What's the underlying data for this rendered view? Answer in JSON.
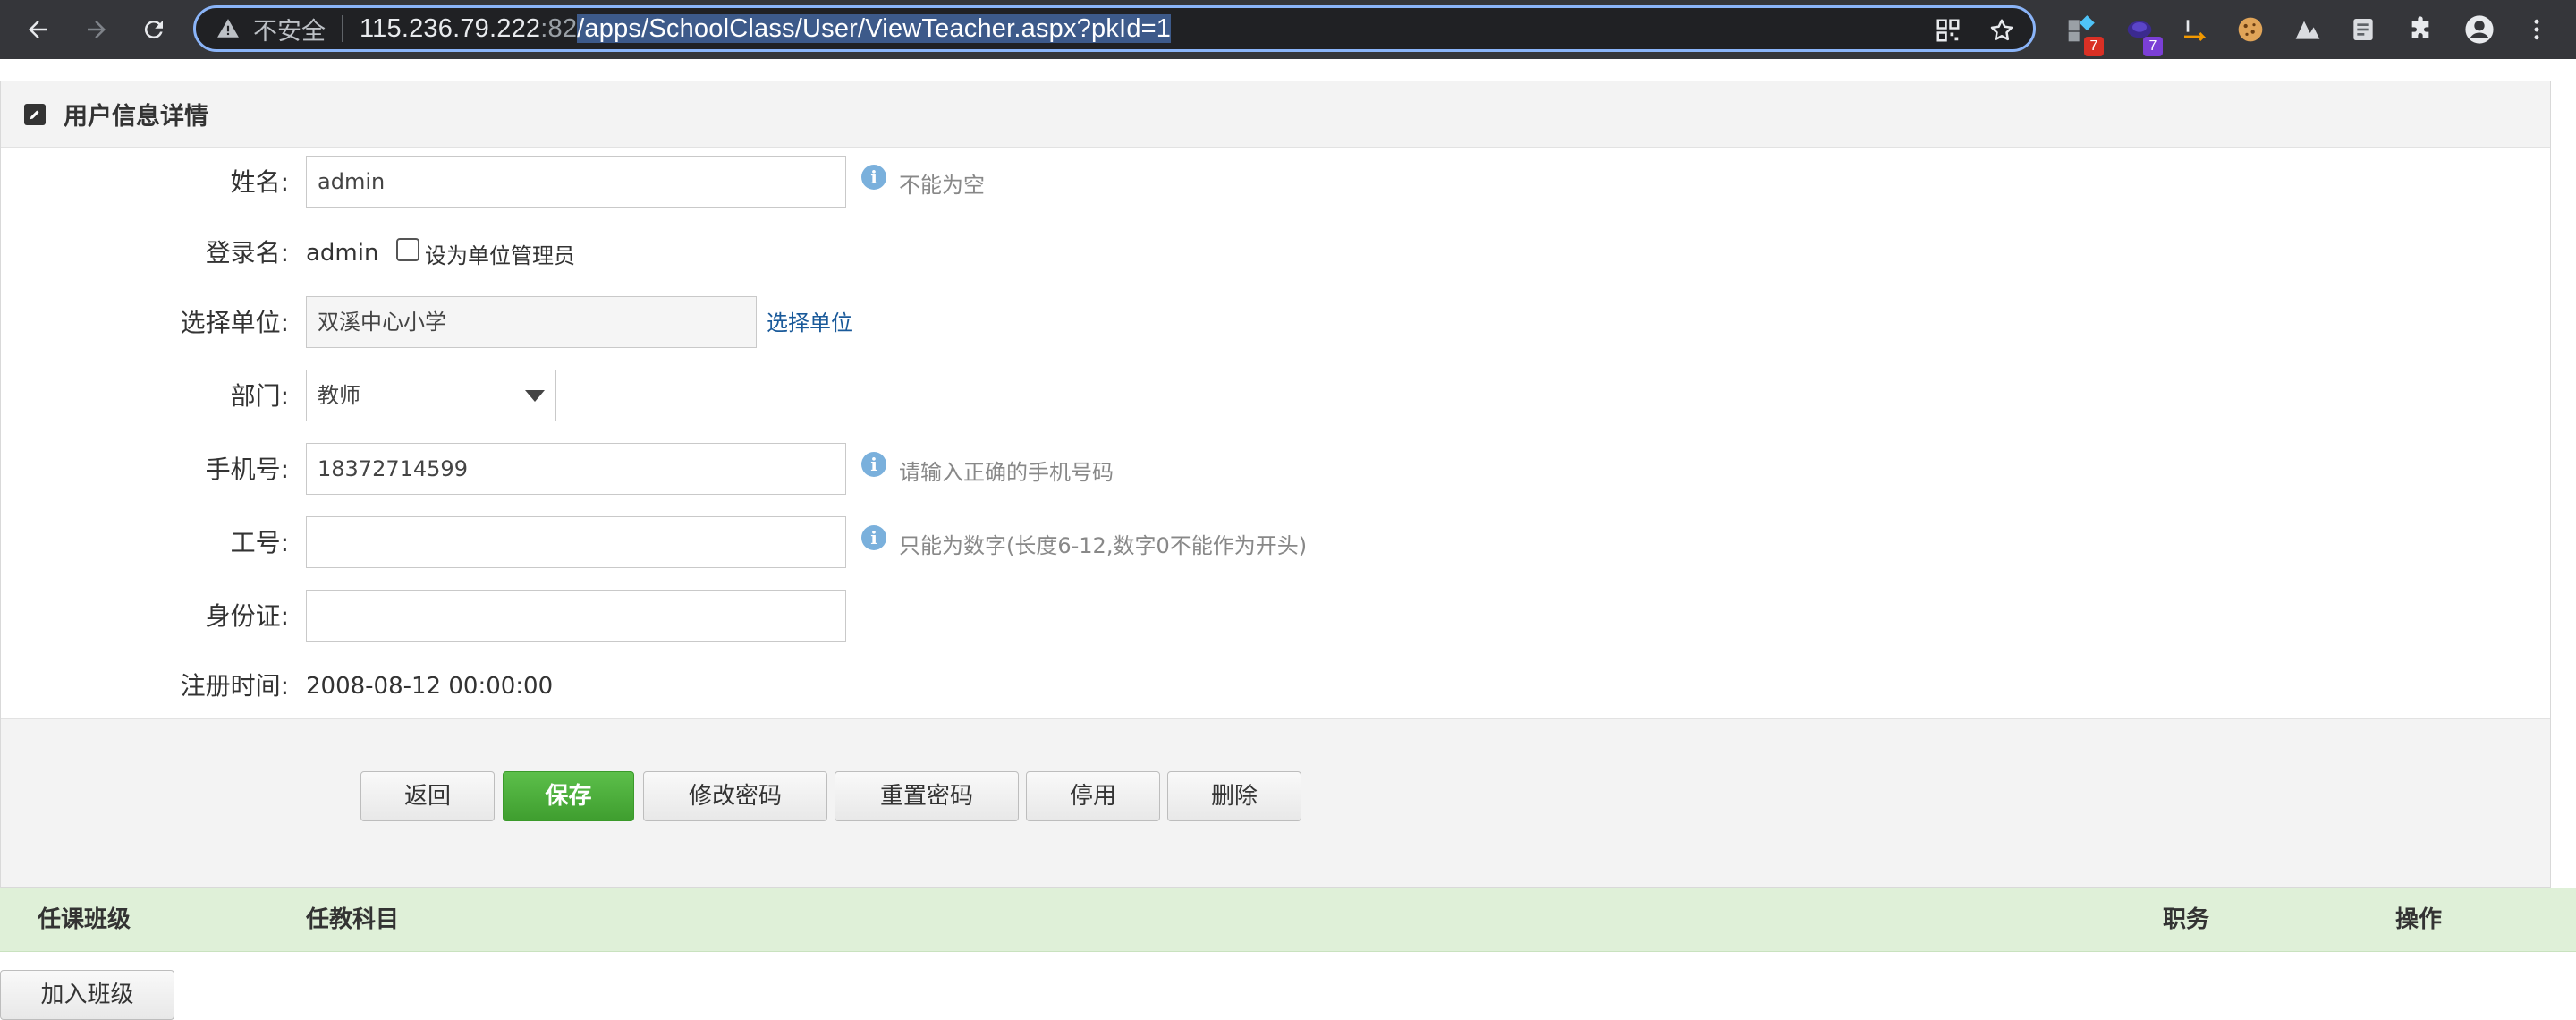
{
  "browser": {
    "security_label": "不安全",
    "url_host": "115.236.79.222",
    "url_port": ":82",
    "url_path": "/apps/SchoolClass/User/ViewTeacher.aspx?pkId=1",
    "extensions": [
      {
        "name": "extension-1",
        "badge": "7",
        "badge_color": "#d93025"
      },
      {
        "name": "extension-2",
        "badge": "7",
        "badge_color": "#7b3fd6"
      }
    ]
  },
  "panel": {
    "title": "用户信息详情"
  },
  "form": {
    "name_label": "姓名:",
    "name_value": "admin",
    "name_hint": "不能为空",
    "login_label": "登录名:",
    "login_value": "admin",
    "unit_admin_checkbox": "设为单位管理员",
    "unit_label": "选择单位:",
    "unit_value": "双溪中心小学",
    "unit_link": "选择单位",
    "dept_label": "部门:",
    "dept_value": "教师",
    "phone_label": "手机号:",
    "phone_value": "18372714599",
    "phone_hint": "请输入正确的手机号码",
    "job_label": "工号:",
    "job_value": "",
    "job_hint": "只能为数字(长度6-12,数字0不能作为开头)",
    "id_label": "身份证:",
    "id_value": "",
    "reg_label": "注册时间:",
    "reg_value": "2008-08-12 00:00:00"
  },
  "buttons": {
    "back": "返回",
    "save": "保存",
    "change_password": "修改密码",
    "reset_password": "重置密码",
    "disable": "停用",
    "delete": "删除"
  },
  "table": {
    "columns": [
      "任课班级",
      "任教科目",
      "职务",
      "操作"
    ]
  },
  "join_class_button": "加入班级"
}
